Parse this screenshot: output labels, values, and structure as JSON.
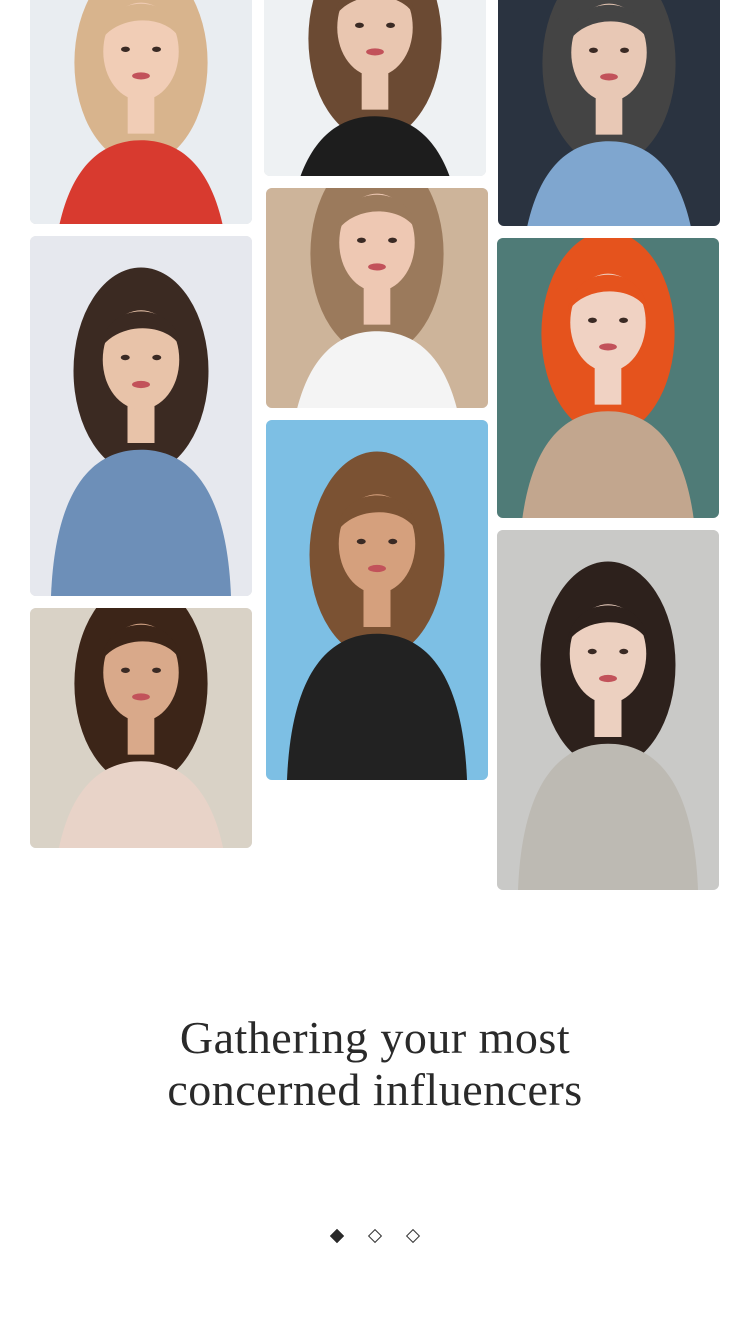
{
  "headline": {
    "line1": "Gathering your most",
    "line2": "concerned influencers"
  },
  "photos": [
    {
      "id": "p1",
      "subject": "woman-red-jacket-drinking-soda",
      "bg": "#e9edf1",
      "accent": "#d83a2f",
      "hair": "#d8b48d",
      "skin": "#f1cdb6"
    },
    {
      "id": "p2",
      "subject": "woman-long-wavy-hair",
      "bg": "#eef1f3",
      "accent": "#1d1d1d",
      "hair": "#6b4a33",
      "skin": "#e9c6b0"
    },
    {
      "id": "p3",
      "subject": "woman-denim-jacket",
      "bg": "#2a3340",
      "accent": "#7fa6cf",
      "hair": "#444",
      "skin": "#e8c8b5"
    },
    {
      "id": "p4",
      "subject": "woman-denim-jacket-patches",
      "bg": "#e6e8ee",
      "accent": "#6d8fb8",
      "hair": "#3b2a22",
      "skin": "#e8c3a9"
    },
    {
      "id": "p5",
      "subject": "woman-white-shirt",
      "bg": "#cdb49a",
      "accent": "#f4f4f4",
      "hair": "#9b7a5c",
      "skin": "#eec8b3"
    },
    {
      "id": "p6",
      "subject": "woman-red-hair-coat",
      "bg": "#4f7b77",
      "accent": "#c2a68e",
      "hair": "#e5531d",
      "skin": "#f0d2c3"
    },
    {
      "id": "p7",
      "subject": "woman-beach-tank-top",
      "bg": "#d9d2c6",
      "accent": "#e8d3c8",
      "hair": "#3c2518",
      "skin": "#d9a98a"
    },
    {
      "id": "p8",
      "subject": "woman-sea-black-top",
      "bg": "#7dbfe4",
      "accent": "#222",
      "hair": "#7b5233",
      "skin": "#d5a07d"
    },
    {
      "id": "p9",
      "subject": "woman-grey-top-earrings",
      "bg": "#c9c9c7",
      "accent": "#bdbab3",
      "hair": "#2d211c",
      "skin": "#ecd0c0"
    }
  ],
  "pager": {
    "count": 3,
    "active_index": 0,
    "active_color": "#2a2a2a"
  }
}
